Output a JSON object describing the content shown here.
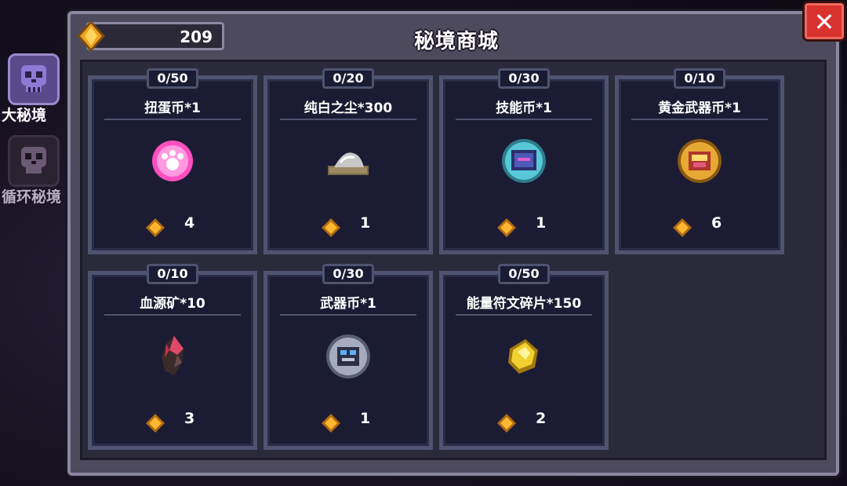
{
  "sidebar": {
    "tabs": [
      {
        "label": "大秘境",
        "active": true
      },
      {
        "label": "循环秘境",
        "active": false
      }
    ]
  },
  "shop": {
    "title": "秘境商城",
    "currency": "209",
    "close_label": "✕",
    "items": [
      {
        "name": "扭蛋币*1",
        "count": "0/50",
        "price": "4",
        "icon": "gacha-coin-icon"
      },
      {
        "name": "纯白之尘*300",
        "count": "0/20",
        "price": "1",
        "icon": "white-dust-icon"
      },
      {
        "name": "技能币*1",
        "count": "0/30",
        "price": "1",
        "icon": "skill-coin-icon"
      },
      {
        "name": "黄金武器币*1",
        "count": "0/10",
        "price": "6",
        "icon": "gold-weapon-coin-icon"
      },
      {
        "name": "血源矿*10",
        "count": "0/10",
        "price": "3",
        "icon": "blood-ore-icon"
      },
      {
        "name": "武器币*1",
        "count": "0/30",
        "price": "1",
        "icon": "weapon-coin-icon"
      },
      {
        "name": "能量符文碎片*150",
        "count": "0/50",
        "price": "2",
        "icon": "energy-rune-shard-icon"
      }
    ]
  },
  "colors": {
    "panel": "#4d4a5e",
    "card": "#1b1c33",
    "gem": "#f0a020",
    "close": "#d8312e"
  }
}
